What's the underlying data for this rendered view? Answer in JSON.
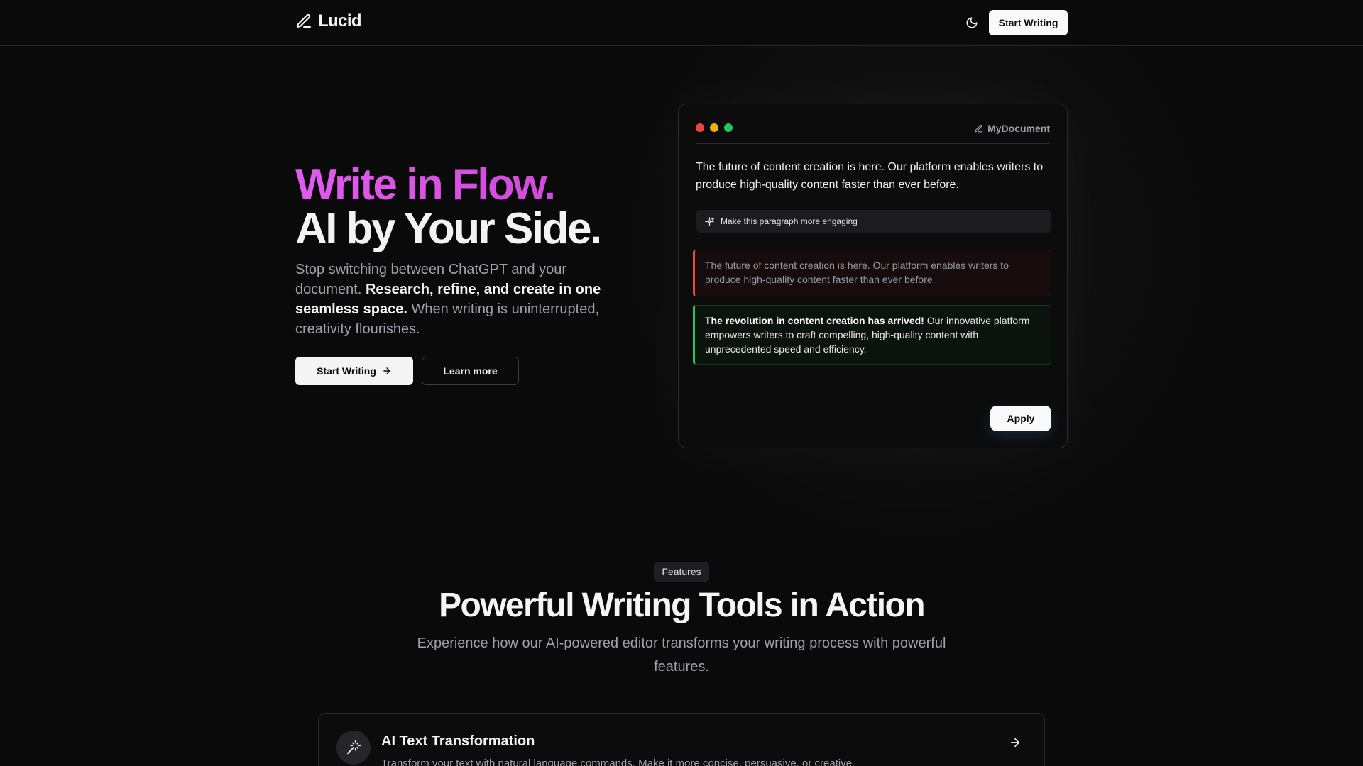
{
  "header": {
    "brand": "Lucid",
    "cta_label": "Start Writing",
    "icons": {
      "logo": "pen-icon",
      "theme": "moon-icon"
    }
  },
  "hero": {
    "title_line1": "Write in Flow.",
    "title_line2": "AI by Your Side.",
    "sub_part1": "Stop switching between ChatGPT and your document. ",
    "sub_bold": "Research, refine, and create in one seamless space.",
    "sub_part2": " When writing is uninterrupted, creativity flourishes.",
    "primary_button": "Start Writing",
    "secondary_button": "Learn more",
    "gradient_colors": [
      "#e15bf0",
      "#cf48d6"
    ]
  },
  "editor": {
    "doc_name": "MyDocument",
    "body_text": "The future of content creation is here. Our platform enables writers to produce high-quality content faster than ever before.",
    "prompt": "Make this paragraph more engaging",
    "original_text": "The future of content creation is here. Our platform enables writers to produce high-quality content faster than ever before.",
    "suggestion_bold": "The revolution in content creation has arrived!",
    "suggestion_rest": " Our innovative platform empowers writers to craft compelling, high-quality content with unprecedented speed and efficiency.",
    "apply_label": "Apply",
    "window_dot_colors": [
      "#ef4444",
      "#eab308",
      "#22c55e"
    ]
  },
  "features": {
    "badge": "Features",
    "title": "Powerful Writing Tools in Action",
    "subtitle": "Experience how our AI-powered editor transforms your writing process with powerful features.",
    "card": {
      "title": "AI Text Transformation",
      "description": "Transform your text with natural language commands. Make it more concise, persuasive, or creative.",
      "icon": "magic-wand-icon"
    }
  }
}
